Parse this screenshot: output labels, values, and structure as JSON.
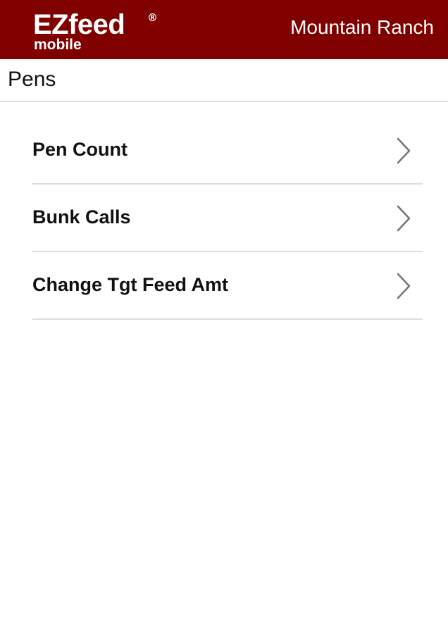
{
  "header": {
    "logo": {
      "main": "EZfeed",
      "registered": "®",
      "sub": "mobile"
    },
    "ranch_name": "Mountain Ranch",
    "background_color": "#800000"
  },
  "page": {
    "title": "Pens"
  },
  "menu": {
    "items": [
      {
        "label": "Pen Count",
        "icon": "chevron-right-icon"
      },
      {
        "label": "Bunk Calls",
        "icon": "chevron-right-icon"
      },
      {
        "label": "Change Tgt Feed Amt",
        "icon": "chevron-right-icon"
      }
    ]
  }
}
